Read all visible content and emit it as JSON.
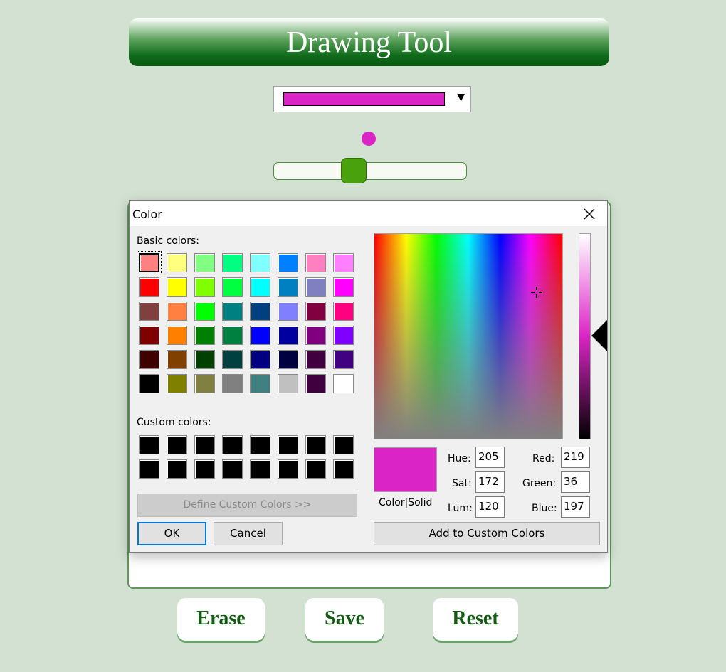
{
  "app": {
    "title": "Drawing Tool",
    "selected_color": "#db24c5",
    "brush_size_fraction": 0.41,
    "buttons": {
      "erase": "Erase",
      "save": "Save",
      "reset": "Reset"
    }
  },
  "dialog": {
    "title": "Color",
    "basic_colors_label": "Basic colors:",
    "custom_colors_label": "Custom colors:",
    "basic_colors": [
      [
        "#ff8080",
        "#ffff80",
        "#80ff80",
        "#00ff80",
        "#80ffff",
        "#0080ff",
        "#ff80c0",
        "#ff80ff"
      ],
      [
        "#ff0000",
        "#ffff00",
        "#80ff00",
        "#00ff40",
        "#00ffff",
        "#0080c0",
        "#8080c0",
        "#ff00ff"
      ],
      [
        "#804040",
        "#ff8040",
        "#00ff00",
        "#008080",
        "#004080",
        "#8080ff",
        "#800040",
        "#ff0080"
      ],
      [
        "#800000",
        "#ff8000",
        "#008000",
        "#008040",
        "#0000ff",
        "#0000a0",
        "#800080",
        "#8000ff"
      ],
      [
        "#400000",
        "#804000",
        "#004000",
        "#004040",
        "#000080",
        "#000040",
        "#400040",
        "#400080"
      ],
      [
        "#000000",
        "#808000",
        "#808040",
        "#808080",
        "#408080",
        "#c0c0c0",
        "#400040",
        "#ffffff"
      ]
    ],
    "selected_basic": [
      0,
      0
    ],
    "custom_colors": [
      [
        "#000000",
        "#000000",
        "#000000",
        "#000000",
        "#000000",
        "#000000",
        "#000000",
        "#000000"
      ],
      [
        "#000000",
        "#000000",
        "#000000",
        "#000000",
        "#000000",
        "#000000",
        "#000000",
        "#000000"
      ]
    ],
    "define_custom_label": "Define Custom Colors >>",
    "ok_label": "OK",
    "cancel_label": "Cancel",
    "preview_label": "Color|Solid",
    "preview_color": "#db24c5",
    "fields": {
      "hue_label": "Hue:",
      "hue": "205",
      "sat_label": "Sat:",
      "sat": "172",
      "lum_label": "Lum:",
      "lum": "120",
      "red_label": "Red:",
      "red": "219",
      "green_label": "Green:",
      "green": "36",
      "blue_label": "Blue:",
      "blue": "197"
    },
    "add_custom_label": "Add to Custom Colors"
  }
}
